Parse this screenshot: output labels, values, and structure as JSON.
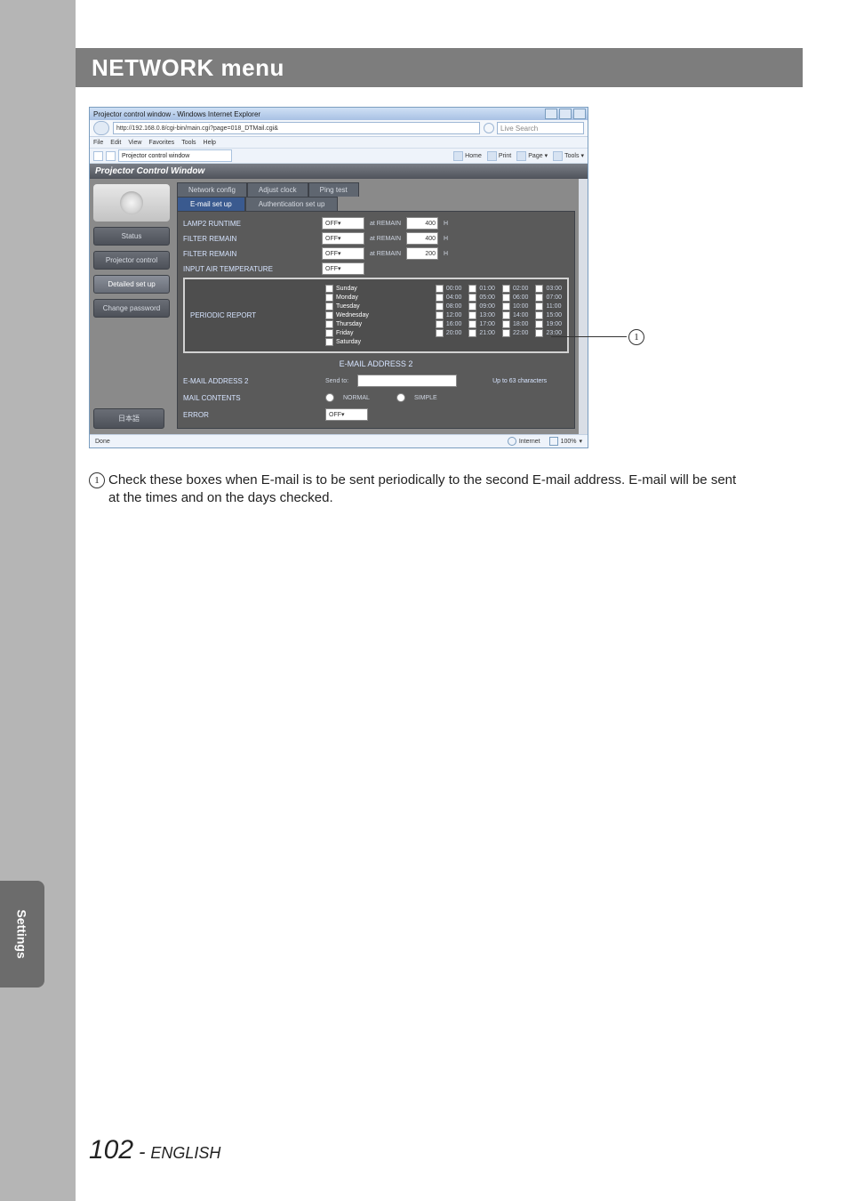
{
  "page": {
    "header_title": "NETWORK menu",
    "side_tab": "Settings",
    "footer_num": "102",
    "footer_sep": "-",
    "footer_lang": "ENGLISH"
  },
  "callout": {
    "marker": "1",
    "text_main": "Check these boxes when E-mail is to be sent periodically to the second E-mail address. E-mail will be sent",
    "text_cont": "at the times and on the days checked."
  },
  "ie": {
    "title": "Projector control window - Windows Internet Explorer",
    "url": "http://192.168.0.8/cgi-bin/main.cgi?page=018_DTMail.cgi&",
    "search_placeholder": "Live Search",
    "menu": [
      "File",
      "Edit",
      "View",
      "Favorites",
      "Tools",
      "Help"
    ],
    "tab_label": "Projector control window",
    "tools": [
      "Home",
      "Print",
      "Page",
      "Tools"
    ],
    "status_left": "Done",
    "status_zone": "Internet",
    "status_zoom": "100%"
  },
  "pcw": {
    "title": "Projector Control Window",
    "side": {
      "status": "Status",
      "control": "Projector control",
      "detailed": "Detailed set up",
      "change": "Change password",
      "jp": "日本語"
    },
    "tabs": {
      "network": "Network config",
      "adjust": "Adjust clock",
      "ping": "Ping test",
      "email": "E-mail set up",
      "auth": "Authentication set up"
    },
    "rows": {
      "lamp2": "LAMP2 RUNTIME",
      "filter_remain1": "FILTER REMAIN",
      "filter_remain2": "FILTER REMAIN",
      "air_temp": "INPUT AIR TEMPERATURE",
      "off": "OFF",
      "at_remain": "at REMAIN",
      "val_400": "400",
      "val_200": "200",
      "unit_h": "H"
    },
    "periodic": {
      "label": "PERIODIC REPORT",
      "days": [
        "Sunday",
        "Monday",
        "Tuesday",
        "Wednesday",
        "Thursday",
        "Friday",
        "Saturday"
      ],
      "hours": [
        [
          "00:00",
          "01:00",
          "02:00",
          "03:00"
        ],
        [
          "04:00",
          "05:00",
          "06:00",
          "07:00"
        ],
        [
          "08:00",
          "09:00",
          "10:00",
          "11:00"
        ],
        [
          "12:00",
          "13:00",
          "14:00",
          "15:00"
        ],
        [
          "16:00",
          "17:00",
          "18:00",
          "19:00"
        ],
        [
          "20:00",
          "21:00",
          "22:00",
          "23:00"
        ]
      ]
    },
    "section2_title": "E-MAIL ADDRESS 2",
    "addr2": {
      "label": "E-MAIL ADDRESS 2",
      "sendto": "Send to:",
      "hint": "Up to 63 characters"
    },
    "contents": {
      "label": "MAIL CONTENTS",
      "normal": "NORMAL",
      "simple": "SIMPLE"
    },
    "error": {
      "label": "ERROR",
      "off": "OFF"
    }
  }
}
